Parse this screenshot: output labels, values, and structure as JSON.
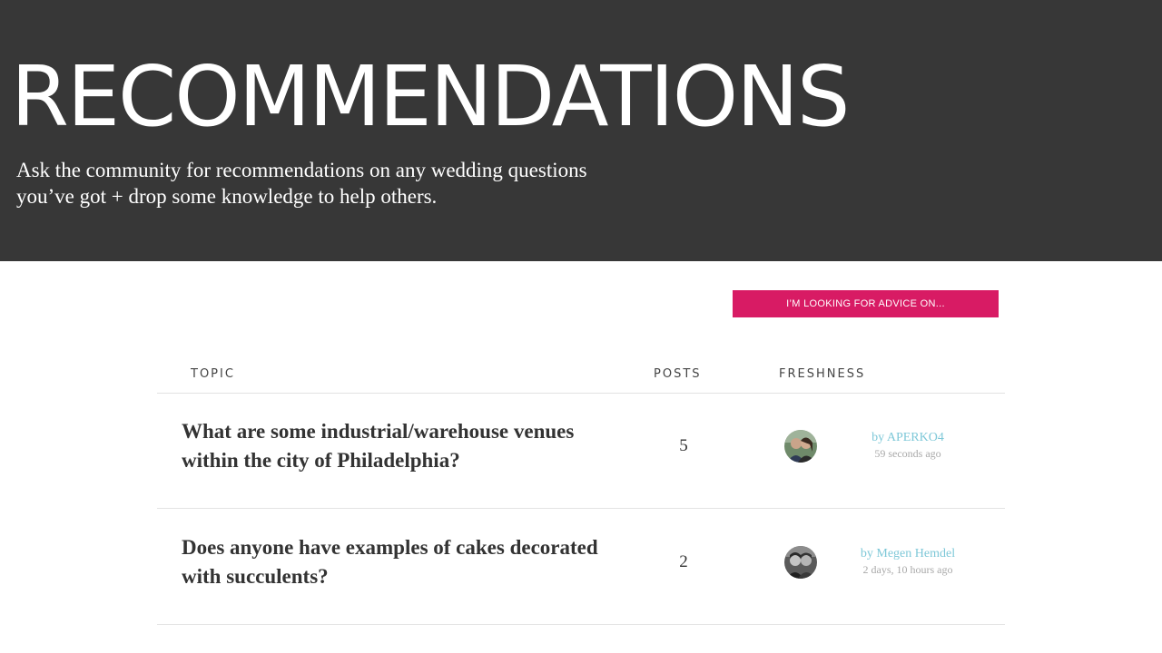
{
  "hero": {
    "title": "RECOMMENDATIONS",
    "subtitle_line1": "Ask the community for recommendations on any wedding questions",
    "subtitle_line2": "you’ve got + drop some knowledge to help others."
  },
  "advice_button": {
    "label": "I’M LOOKING FOR ADVICE ON..."
  },
  "table": {
    "columns": {
      "topic": "TOPIC",
      "posts": "POSTS",
      "freshness": "FRESHNESS"
    },
    "rows": [
      {
        "title_line1": "What are some industrial/warehouse venues",
        "title_line2": "within the city of Philadelphia?",
        "posts": "5",
        "author": "by APERKO4",
        "time": "59 seconds ago"
      },
      {
        "title_line1": "Does anyone have examples of cakes decorated",
        "title_line2": "with succulents?",
        "posts": "2",
        "author": "by Megen Hemdel",
        "time": "2 days, 10 hours ago"
      }
    ]
  },
  "colors": {
    "hero_bg": "#373737",
    "accent": "#d81b64",
    "link": "#7ec8d8"
  }
}
